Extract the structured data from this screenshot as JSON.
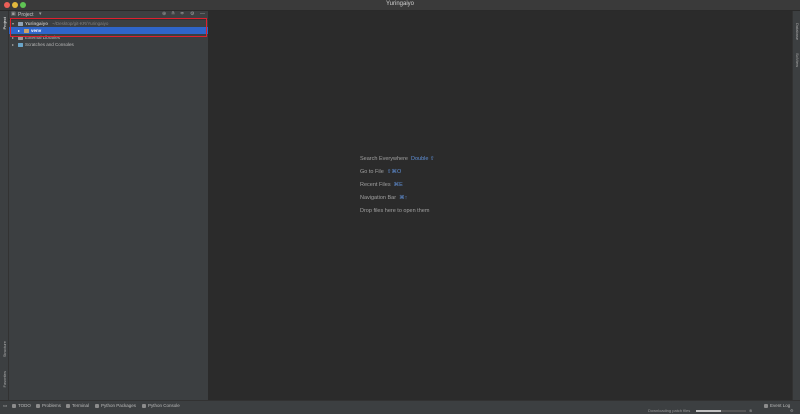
{
  "window": {
    "title": "Yuringaiyo"
  },
  "left_strip": {
    "project_tab": "Project",
    "structure_tab": "Structure",
    "favorites_tab": "Favorites"
  },
  "right_strip": {
    "database_tab": "Database",
    "sciview_tab": "SciView"
  },
  "project_panel": {
    "header": "Project",
    "tree": [
      {
        "label": "Yuringaiyo",
        "path": "~/Desktop/git-KR/Yuringaiyo",
        "expanded": true,
        "selected": false
      },
      {
        "label": "venv",
        "expanded": false,
        "selected": true
      },
      {
        "label": "External Libraries",
        "expanded": false,
        "selected": false
      },
      {
        "label": "Scratches and Consoles",
        "expanded": false,
        "selected": false
      }
    ]
  },
  "editor_hints": [
    {
      "text": "Search Everywhere",
      "shortcut": "Double ⇧"
    },
    {
      "text": "Go to File",
      "shortcut": "⇧⌘O"
    },
    {
      "text": "Recent Files",
      "shortcut": "⌘E"
    },
    {
      "text": "Navigation Bar",
      "shortcut": "⌘↑"
    },
    {
      "text": "Drop files here to open them",
      "shortcut": ""
    }
  ],
  "bottom_bar": {
    "tabs": [
      "TODO",
      "Problems",
      "Terminal",
      "Python Packages",
      "Python Console"
    ],
    "event_log": "Event Log",
    "status_text": "Downloading patch files",
    "progress": 0.5
  },
  "colors": {
    "accent": "#2f65ca",
    "highlight_box": "#e0202f",
    "shortcut": "#5f8fd6"
  }
}
